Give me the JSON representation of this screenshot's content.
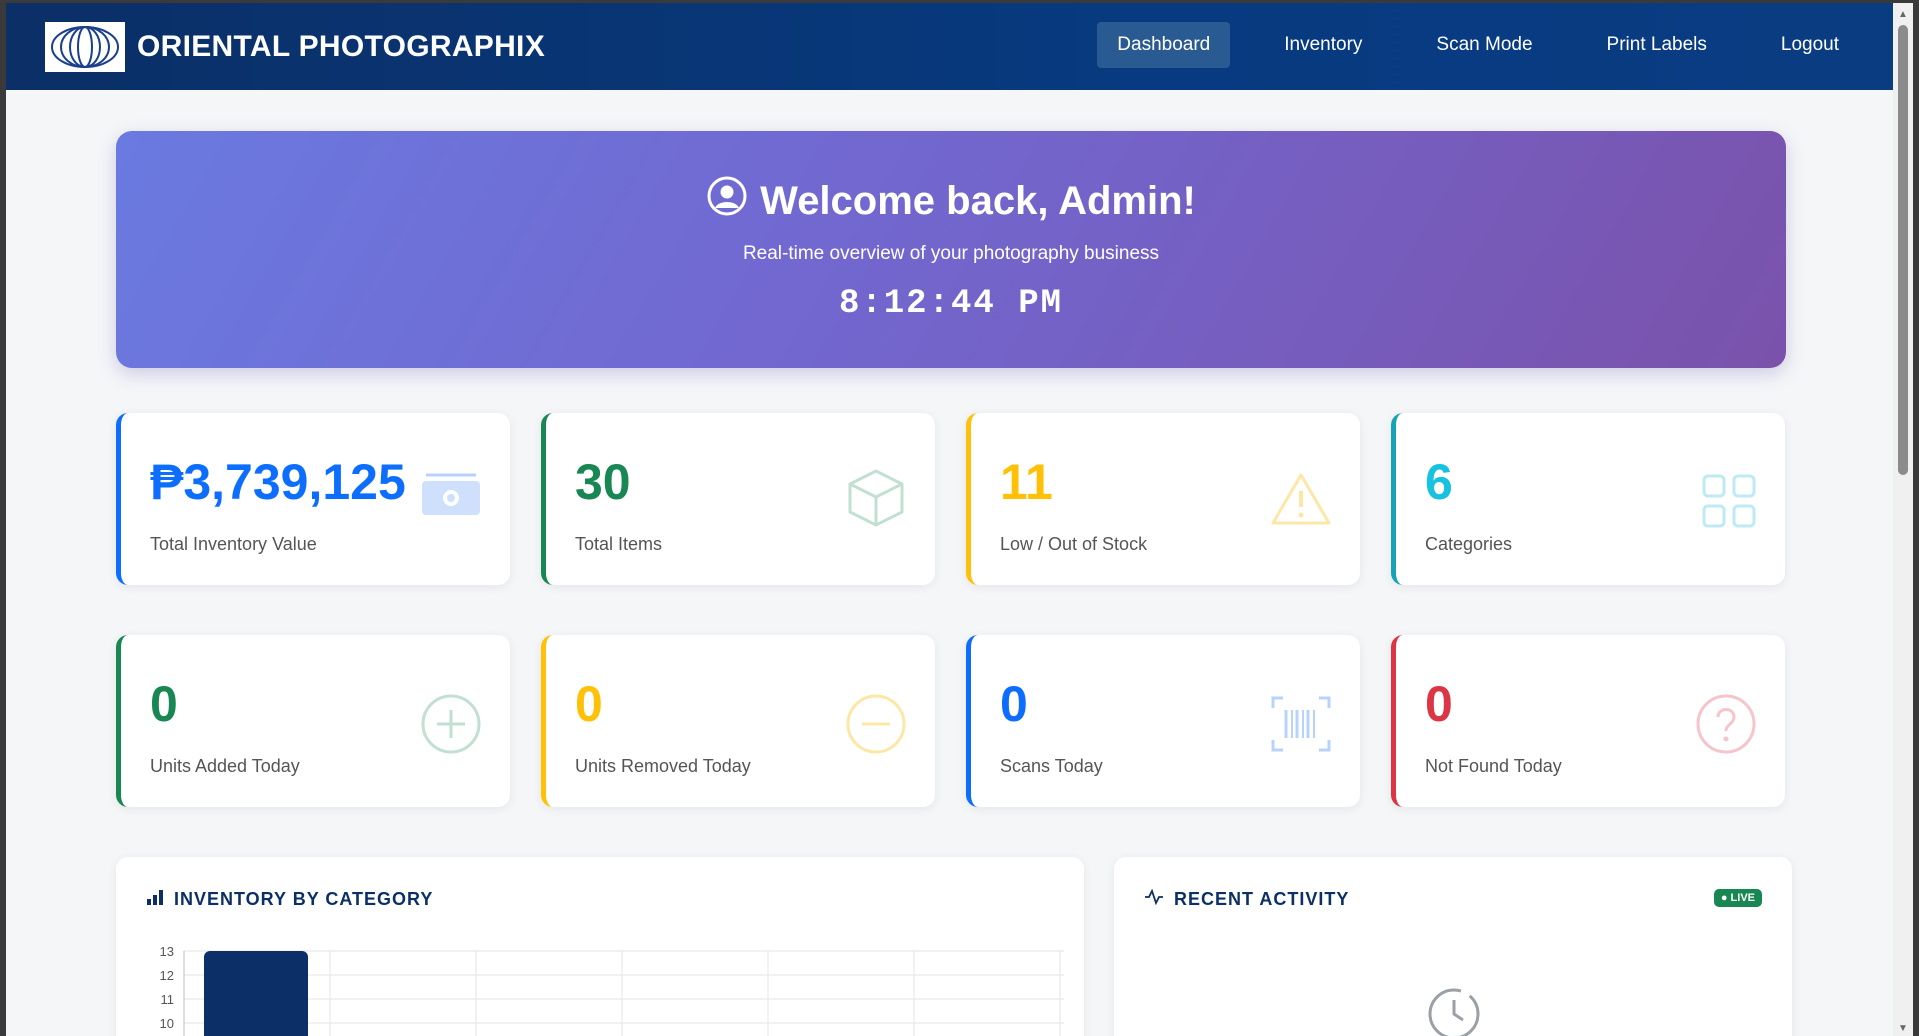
{
  "brand": {
    "name": "ORIENTAL PHOTOGRAPHIX",
    "logo_icon": "concentric-rings-logo"
  },
  "nav": {
    "items": [
      {
        "label": "Dashboard",
        "active": true
      },
      {
        "label": "Inventory",
        "active": false
      },
      {
        "label": "Scan Mode",
        "active": false
      },
      {
        "label": "Print Labels",
        "active": false
      },
      {
        "label": "Logout",
        "active": false
      }
    ]
  },
  "hero": {
    "title": "Welcome back, Admin!",
    "subtitle": "Real-time overview of your photography business",
    "clock": "8:12:44 PM",
    "icon": "user-circle-icon"
  },
  "stats_top": [
    {
      "value": "₱3,739,125",
      "label": "Total Inventory Value",
      "color": "#0d6efd",
      "icon": "cash-icon"
    },
    {
      "value": "30",
      "label": "Total Items",
      "color": "#198754",
      "icon": "box-icon"
    },
    {
      "value": "11",
      "label": "Low / Out of Stock",
      "color": "#ffc107",
      "icon": "warning-icon"
    },
    {
      "value": "6",
      "label": "Categories",
      "color": "#17a2b8",
      "icon": "grid-icon"
    }
  ],
  "stats_bottom": [
    {
      "value": "0",
      "label": "Units Added Today",
      "color": "#198754",
      "icon": "plus-circle-icon"
    },
    {
      "value": "0",
      "label": "Units Removed Today",
      "color": "#ffc107",
      "icon": "minus-circle-icon"
    },
    {
      "value": "0",
      "label": "Scans Today",
      "color": "#0d6efd",
      "icon": "barcode-scan-icon"
    },
    {
      "value": "0",
      "label": "Not Found Today",
      "color": "#dc3545",
      "icon": "question-circle-icon"
    }
  ],
  "inventory_panel": {
    "title": "INVENTORY BY CATEGORY",
    "icon": "bar-chart-icon"
  },
  "activity_panel": {
    "title": "RECENT ACTIVITY",
    "live": "LIVE",
    "icon": "activity-icon",
    "empty_icon": "clock-icon"
  },
  "chart_data": {
    "type": "bar",
    "y_ticks": [
      "13",
      "12",
      "11",
      "10"
    ],
    "visible_values": [
      13
    ],
    "ylim_visible": [
      10,
      13
    ],
    "color": "#0b2f66"
  }
}
